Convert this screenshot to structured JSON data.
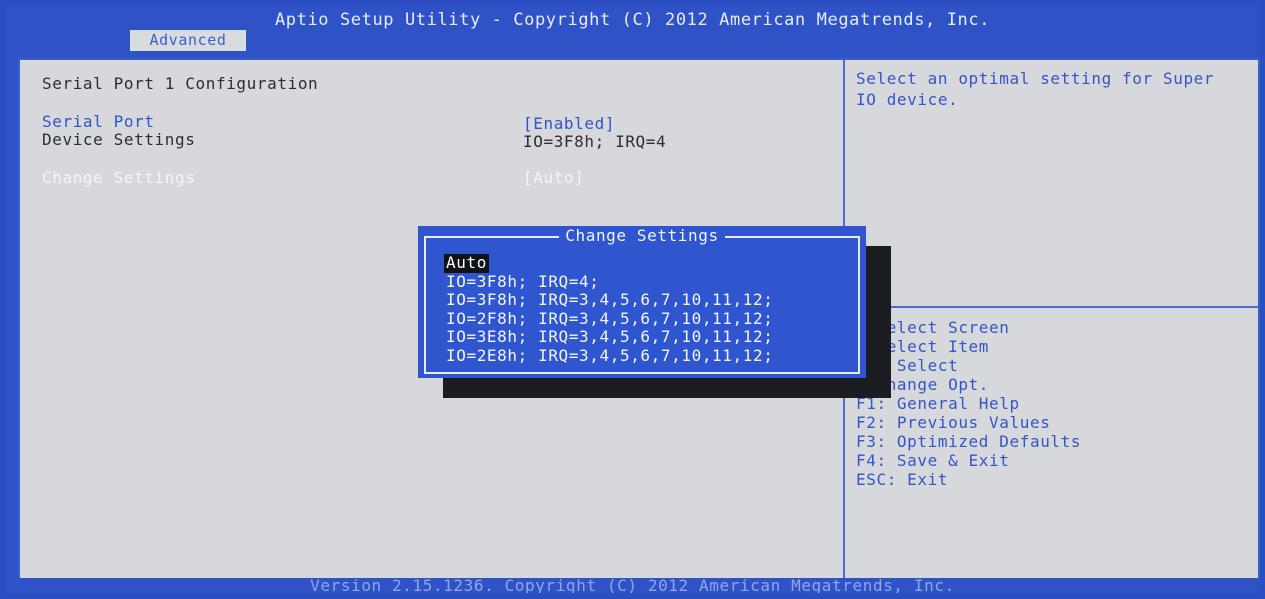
{
  "title": "Aptio Setup Utility - Copyright (C) 2012 American Megatrends, Inc.",
  "tab": "Advanced",
  "main": {
    "section_title": "Serial Port 1 Configuration",
    "items": [
      {
        "label": "Serial Port",
        "value": "[Enabled]"
      },
      {
        "label": "Device Settings",
        "value": "IO=3F8h; IRQ=4"
      },
      {
        "label": "Change Settings",
        "value": "[Auto]"
      }
    ]
  },
  "help": {
    "text": "Select an optimal setting for Super IO device."
  },
  "keys": [
    "  Select Screen",
    "  Select Item",
    "er: Select",
    ": Change Opt.",
    "F1: General Help",
    "F2: Previous Values",
    "F3: Optimized Defaults",
    "F4: Save & Exit",
    "ESC: Exit"
  ],
  "popup": {
    "title": "Change Settings",
    "options": [
      "Auto",
      "IO=3F8h; IRQ=4;",
      "IO=3F8h; IRQ=3,4,5,6,7,10,11,12;",
      "IO=2F8h; IRQ=3,4,5,6,7,10,11,12;",
      "IO=3E8h; IRQ=3,4,5,6,7,10,11,12;",
      "IO=2E8h; IRQ=3,4,5,6,7,10,11,12;"
    ],
    "selected_index": 0
  },
  "footer": "Version 2.15.1236. Copyright (C) 2012 American Megatrends, Inc.",
  "colors": {
    "bios_blue": "#2f53c6",
    "panel_gray": "#d6d8dc",
    "popup_blue": "#2f56cf",
    "highlight_white": "#f4f5f7"
  }
}
